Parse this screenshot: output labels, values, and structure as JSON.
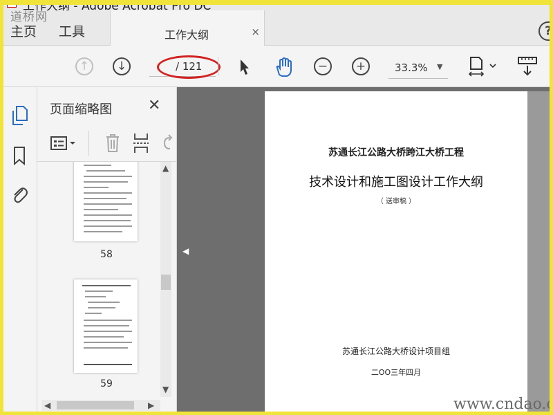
{
  "window": {
    "title": "工作大纲 - Adobe Acrobat Pro DC"
  },
  "watermarks": {
    "top_left": "道桥网",
    "bottom_right": "www.cndao.c"
  },
  "nav": {
    "home": "主页",
    "tools": "工具",
    "tab_label": "工作大纲",
    "tab_close": "×",
    "help": "?"
  },
  "toolbar": {
    "page_total": "/ 121",
    "zoom": "33.3%"
  },
  "panel": {
    "title": "页面缩略图",
    "close": "✕"
  },
  "thumbnails": [
    {
      "page": "58"
    },
    {
      "page": "59"
    }
  ],
  "document": {
    "project": "苏通长江公路大桥跨江大桥工程",
    "title": "技术设计和施工图设计工作大纲",
    "subtitle": "（ 送审稿 ）",
    "org": "苏通长江公路大桥设计项目组",
    "date": "二ΟΟ三年四月"
  },
  "colors": {
    "highlight": "#d32222",
    "frame": "#f0e33a",
    "doc_bg": "#6e6e6e"
  }
}
